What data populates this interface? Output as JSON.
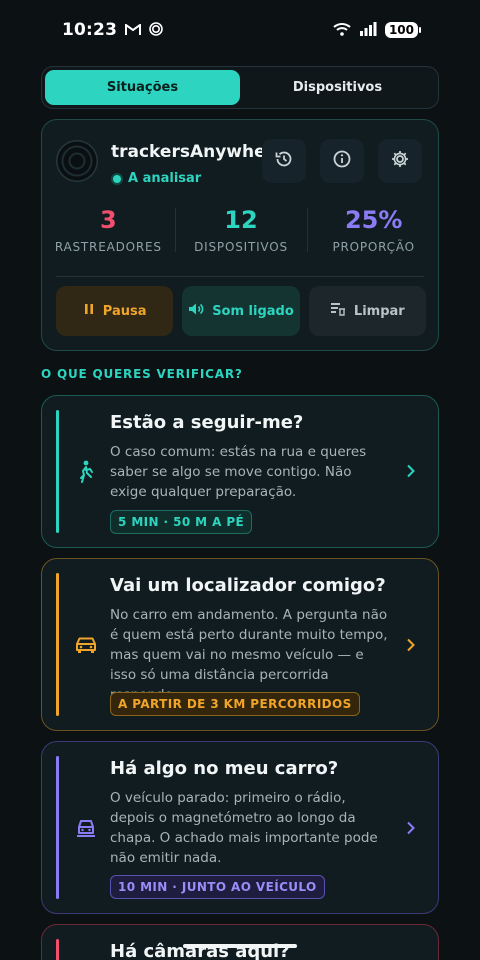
{
  "status_bar": {
    "time": "10:23",
    "battery": "100"
  },
  "tabs": [
    {
      "label": "Situações",
      "active": true
    },
    {
      "label": "Dispositivos",
      "active": false
    }
  ],
  "summary": {
    "app_name": "trackersAnywhere",
    "status": "A analisar",
    "icons": [
      "history-icon",
      "info-icon",
      "settings-icon"
    ],
    "stats": [
      {
        "value": "3",
        "label": "RASTREADORES",
        "color": "#f0506e"
      },
      {
        "value": "12",
        "label": "DISPOSITIVOS",
        "color": "#2dd4bf"
      },
      {
        "value": "25%",
        "label": "PROPORÇÃO",
        "color": "#8b7cf6"
      }
    ],
    "actions": [
      {
        "label": "Pausa",
        "icon": "pause-icon"
      },
      {
        "label": "Som ligado",
        "icon": "speaker-icon"
      },
      {
        "label": "Limpar",
        "icon": "clear-all-icon"
      }
    ]
  },
  "section_title": "O QUE QUERES VERIFICAR?",
  "situations": [
    {
      "title": "Estão a seguir-me?",
      "description": "O caso comum: estás na rua e queres saber se algo se move contigo. Não exige qualquer preparação.",
      "tag": "5 MIN · 50 M A PÉ",
      "icon": "walking-icon",
      "color": "#2dd4bf"
    },
    {
      "title": "Vai um localizador comigo?",
      "description": "No carro em andamento. A pergunta não é quem está perto durante muito tempo, mas quem vai no mesmo veículo — e isso só uma distância percorrida responde.",
      "tag": "A PARTIR DE 3 KM PERCORRIDOS",
      "icon": "car-icon",
      "color": "#f0a52a"
    },
    {
      "title": "Há algo no meu carro?",
      "description": "O veículo parado: primeiro o rádio, depois o magnetómetro ao longo da chapa. O achado mais importante pode não emitir nada.",
      "tag": "10 MIN · JUNTO AO VEÍCULO",
      "icon": "parked-car-icon",
      "color": "#8b7cf6"
    },
    {
      "title": "Há câmaras aqui?",
      "color": "#f0506e"
    }
  ]
}
